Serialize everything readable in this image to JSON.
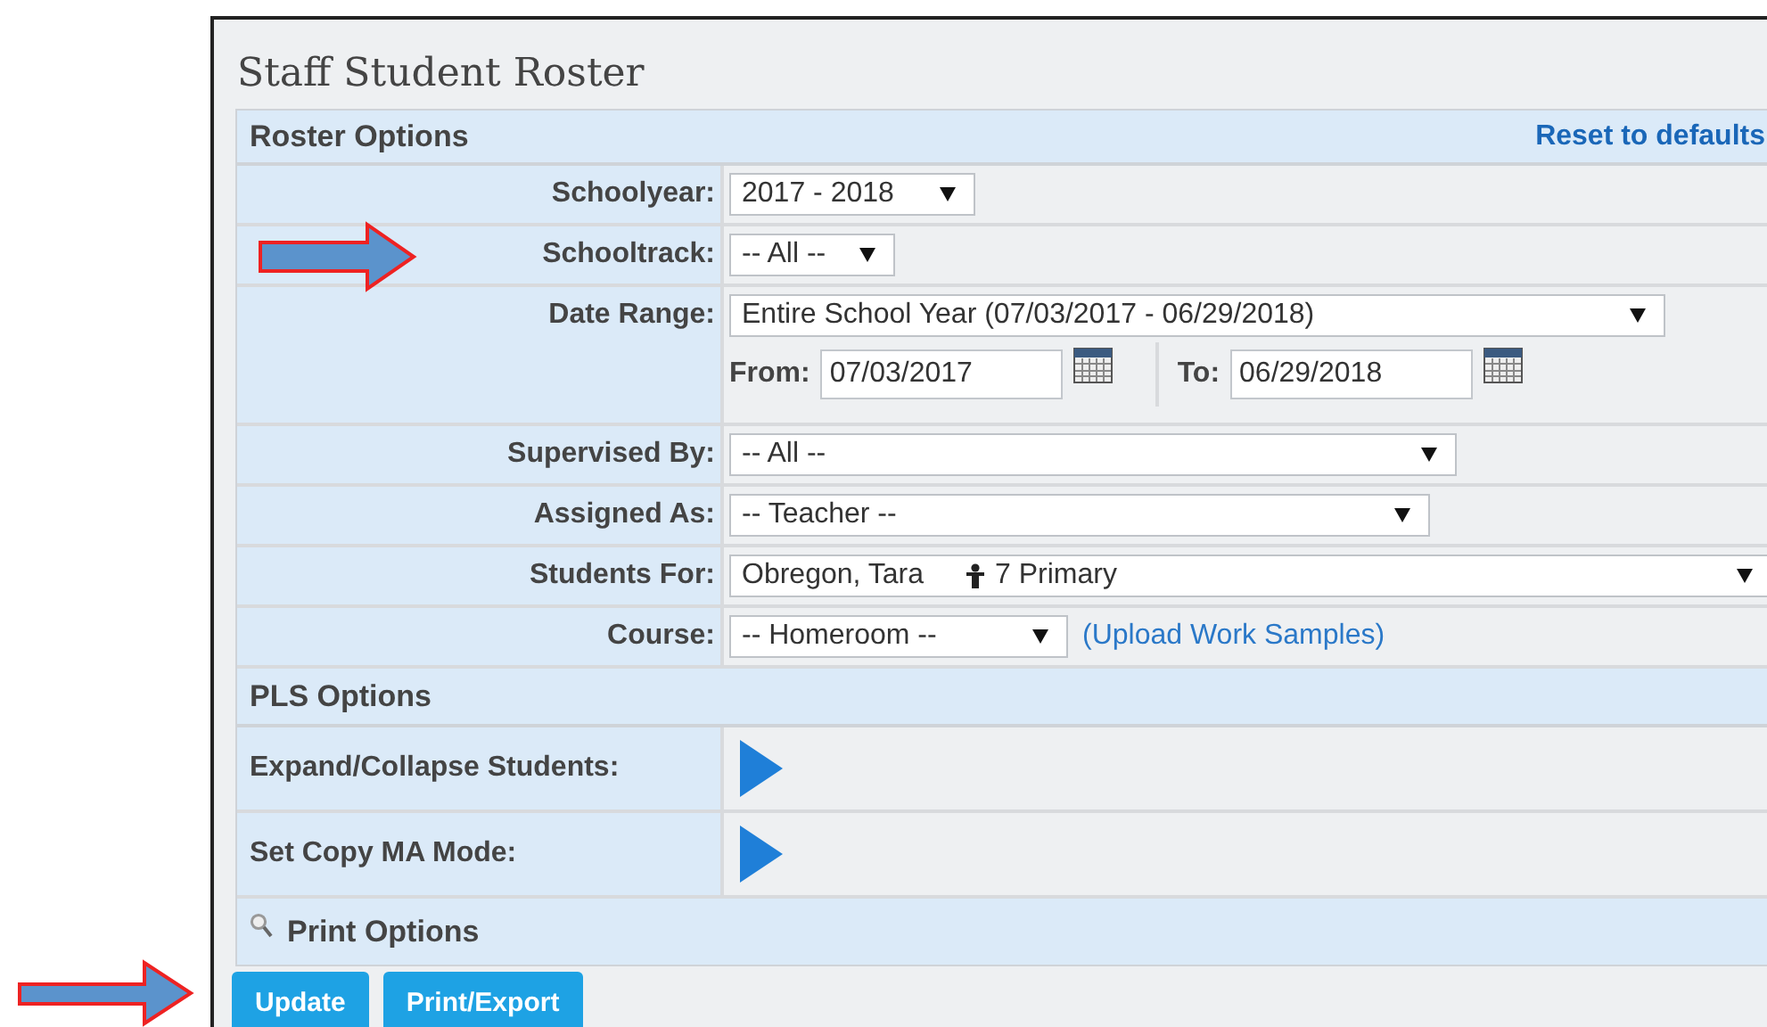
{
  "title": "Staff Student Roster",
  "roster_options": {
    "heading": "Roster Options",
    "reset_link": "Reset to defaults"
  },
  "fields": [
    {
      "kind": "select",
      "label": "Schoolyear:",
      "value": "2017 - 2018"
    },
    {
      "kind": "select",
      "label": "Schooltrack:",
      "value": "-- All --"
    },
    {
      "kind": "date_range",
      "label": "Date Range:",
      "value": "Entire School Year (07/03/2017 - 06/29/2018)",
      "from_label": "From:",
      "from": "07/03/2017",
      "to_label": "To:",
      "to": "06/29/2018"
    },
    {
      "kind": "select",
      "label": "Supervised By:",
      "value": "-- All --"
    },
    {
      "kind": "select",
      "label": "Assigned As:",
      "value": "-- Teacher --"
    },
    {
      "kind": "person",
      "label": "Students For:",
      "value": "Obregon, Tara",
      "detail": "7 Primary"
    },
    {
      "kind": "select_link",
      "label": "Course:",
      "value": "-- Homeroom --",
      "link": "(Upload Work Samples)"
    }
  ],
  "pls_options": {
    "heading": "PLS Options",
    "toggles": [
      {
        "label": "Expand/Collapse Students:"
      },
      {
        "label": "Set Copy MA Mode:"
      }
    ]
  },
  "print_options": "Print Options",
  "buttons": [
    "Update",
    "Print/Export"
  ]
}
